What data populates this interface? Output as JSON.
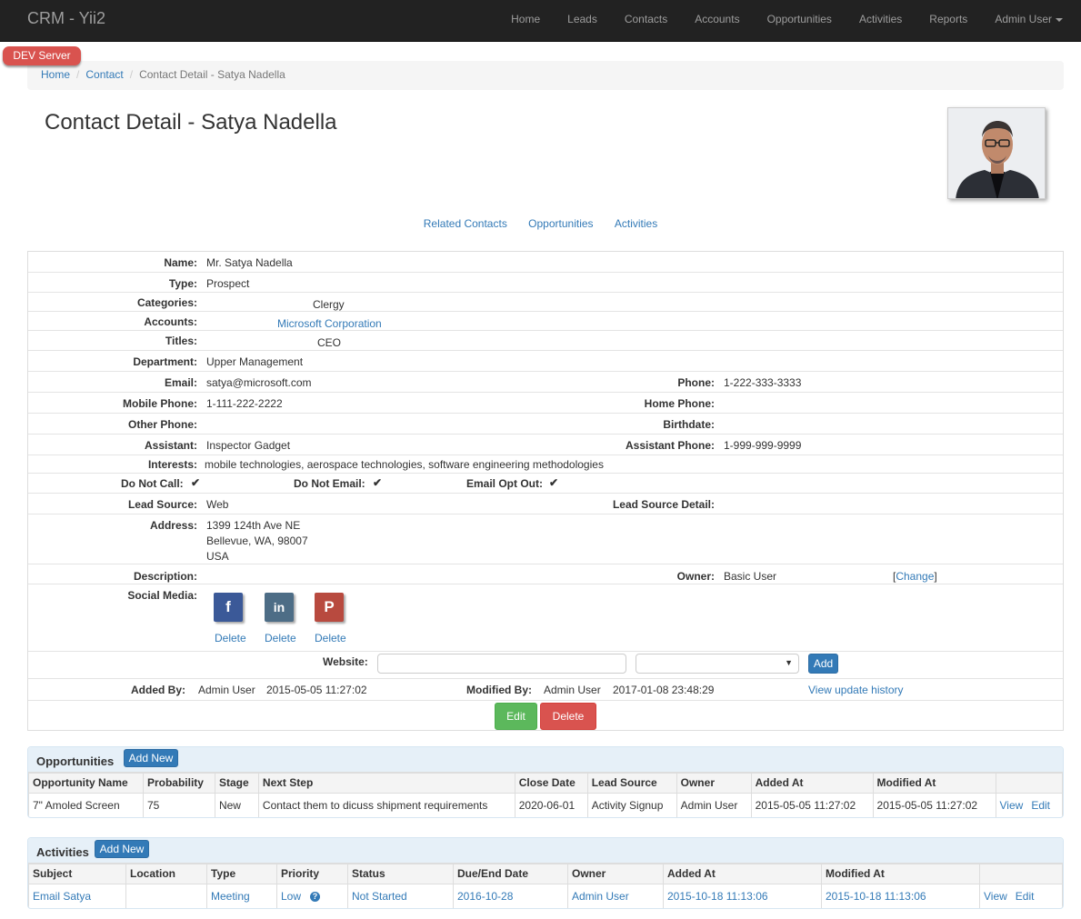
{
  "app": {
    "brand": "CRM - Yii2"
  },
  "nav": {
    "items": [
      "Home",
      "Leads",
      "Contacts",
      "Accounts",
      "Opportunities",
      "Activities",
      "Reports"
    ],
    "user": "Admin User"
  },
  "badge": "DEV  Server",
  "breadcrumb": {
    "home": "Home",
    "contact": "Contact",
    "current": "Contact Detail - Satya Nadella"
  },
  "page": {
    "title": "Contact Detail - Satya Nadella"
  },
  "tabs": [
    "Related Contacts",
    "Opportunities",
    "Activities"
  ],
  "detail": {
    "name_label": "Name:",
    "name": "Mr. Satya Nadella",
    "type_label": "Type:",
    "type": "Prospect",
    "categories_label": "Categories:",
    "categories": "Clergy",
    "accounts_label": "Accounts:",
    "accounts": "Microsoft Corporation",
    "titles_label": "Titles:",
    "titles": "CEO",
    "department_label": "Department:",
    "department": "Upper Management",
    "email_label": "Email:",
    "email": "satya@microsoft.com",
    "phone_label": "Phone:",
    "phone": "1-222-333-3333",
    "mobile_label": "Mobile Phone:",
    "mobile": "1-111-222-2222",
    "home_phone_label": "Home Phone:",
    "other_phone_label": "Other Phone:",
    "birthdate_label": "Birthdate:",
    "assistant_label": "Assistant:",
    "assistant": "Inspector Gadget",
    "assistant_phone_label": "Assistant Phone:",
    "assistant_phone": "1-999-999-9999",
    "interests_label": "Interests:",
    "interests": "mobile technologies, aerospace technologies, software engineering methodologies",
    "dnc_label": "Do Not Call:",
    "dne_label": "Do Not Email:",
    "optout_label": "Email Opt Out:",
    "check": "✔",
    "lead_source_label": "Lead Source:",
    "lead_source": "Web",
    "lead_source_detail_label": "Lead Source Detail:",
    "address_label": "Address:",
    "address_line1": "1399 124th Ave NE",
    "address_line2": "Bellevue, WA, 98007",
    "address_line3": "USA",
    "description_label": "Description:",
    "owner_label": "Owner:",
    "owner": "Basic User",
    "change_open": "[",
    "change": "Change",
    "change_close": "]",
    "social_label": "Social Media:",
    "social": [
      {
        "icon": "facebook-icon",
        "glyph": "f",
        "color": "#3b5998",
        "delete": "Delete"
      },
      {
        "icon": "linkedin-icon",
        "glyph": "in",
        "color": "#4d6d86",
        "delete": "Delete"
      },
      {
        "icon": "pinterest-icon",
        "glyph": "P",
        "color": "#b84a3f",
        "delete": "Delete"
      }
    ],
    "website_label": "Website:",
    "add": "Add",
    "added_by_label": "Added By:",
    "added_by": "Admin User",
    "added_at": "2015-05-05 11:27:02",
    "modified_by_label": "Modified By:",
    "modified_by": "Admin User",
    "modified_at": "2017-01-08 23:48:29",
    "history": "View update history",
    "edit": "Edit",
    "delete": "Delete"
  },
  "opportunities": {
    "title": "Opportunities",
    "add_new": "Add New",
    "headers": [
      "Opportunity Name",
      "Probability",
      "Stage",
      "Next Step",
      "Close Date",
      "Lead Source",
      "Owner",
      "Added At",
      "Modified At"
    ],
    "rows": [
      {
        "name": "7\" Amoled Screen",
        "probability": "75",
        "stage": "New",
        "next_step": "Contact them to dicuss shipment requirements",
        "close_date": "2020-06-01",
        "lead_source": "Activity Signup",
        "owner": "Admin User",
        "added_at": "2015-05-05 11:27:02",
        "modified_at": "2015-05-05 11:27:02",
        "view": "View",
        "edit": "Edit"
      }
    ]
  },
  "activities": {
    "title": "Activities",
    "add_new": "Add New",
    "headers": [
      "Subject",
      "Location",
      "Type",
      "Priority",
      "Status",
      "Due/End Date",
      "Owner",
      "Added At",
      "Modified At"
    ],
    "rows": [
      {
        "subject": "Email Satya",
        "location": "",
        "type": "Meeting",
        "priority": "Low",
        "status": "Not Started",
        "due": "2016-10-28",
        "owner": "Admin User",
        "added_at": "2015-10-18 11:13:06",
        "modified_at": "2015-10-18 11:13:06",
        "view": "View",
        "edit": "Edit"
      }
    ]
  },
  "colors": {
    "navbar": "#222222",
    "link": "#337ab7",
    "danger": "#d9534f",
    "success": "#5cb85c",
    "panel_header": "#e6f0f8"
  }
}
